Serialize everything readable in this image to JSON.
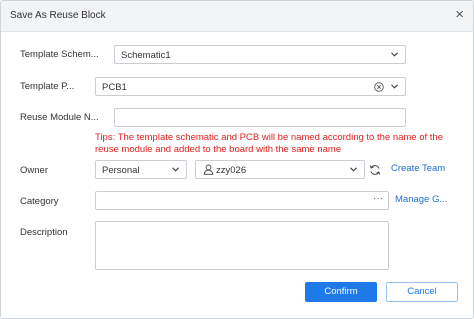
{
  "dialog": {
    "title": "Save As Reuse Block",
    "close_glyph": "×"
  },
  "form": {
    "template_schematic": {
      "label": "Template Schem...",
      "value": "Schematic1"
    },
    "template_pcb": {
      "label": "Template P...",
      "value": "PCB1"
    },
    "reuse_module_name": {
      "label": "Reuse Module N...",
      "value": ""
    },
    "tips": "Tips: The template schematic and PCB will be named according to the name of the reuse module and added to the board with the same name",
    "owner": {
      "label": "Owner",
      "type_value": "Personal",
      "user_value": "zzy026",
      "create_team_label": "Create Team"
    },
    "category": {
      "label": "Category",
      "value": "",
      "ellipsis": "···",
      "manage_label": "Manage G..."
    },
    "description": {
      "label": "Description",
      "value": ""
    }
  },
  "footer": {
    "confirm_label": "Confirm",
    "cancel_label": "Cancel"
  },
  "colors": {
    "accent": "#1e7ae8",
    "tip_red": "#e02020",
    "link_blue": "#1f6fd1"
  },
  "icons": {
    "close": "close-icon",
    "chevron": "chevron-down-icon",
    "clear": "clear-circle-icon",
    "user": "user-icon",
    "refresh": "refresh-icon",
    "more": "ellipsis-icon"
  }
}
